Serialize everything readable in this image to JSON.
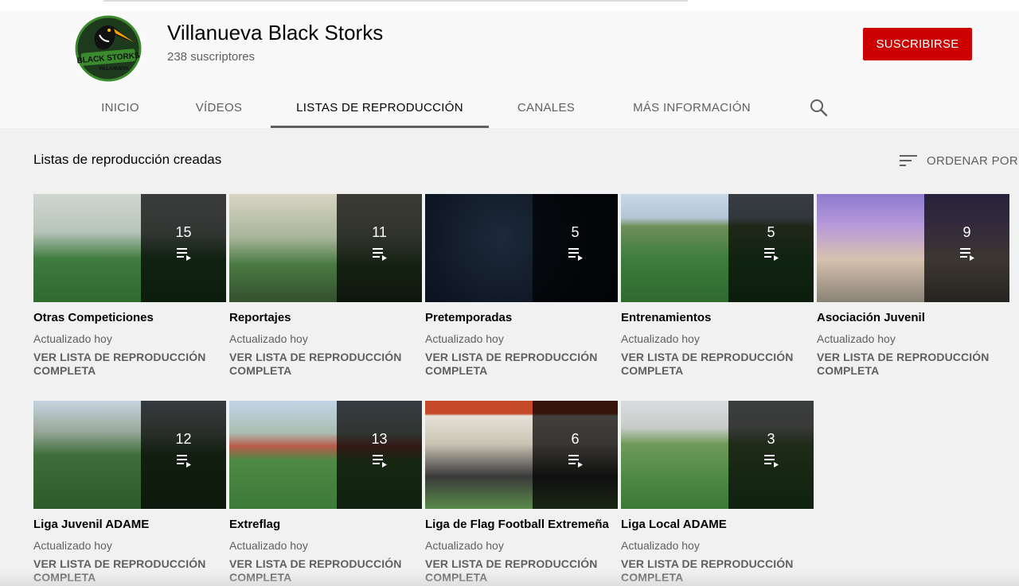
{
  "channel": {
    "name": "Villanueva Black Storks",
    "subscribers": "238 suscriptores",
    "subscribe_label": "SUSCRIBIRSE",
    "logo_text": "BLACK STORKS",
    "logo_subtext": "VILLANUEVA"
  },
  "tabs": [
    {
      "label": "INICIO"
    },
    {
      "label": "VÍDEOS"
    },
    {
      "label": "LISTAS DE REPRODUCCIÓN"
    },
    {
      "label": "CANALES"
    },
    {
      "label": "MÁS INFORMACIÓN"
    }
  ],
  "active_tab": "LISTAS DE REPRODUCCIÓN",
  "section": {
    "title": "Listas de reproducción creadas",
    "sort_label": "ORDENAR POR"
  },
  "icons": {
    "search": "search-icon",
    "sort": "sort-icon",
    "playlist": "playlist-icon"
  },
  "colors": {
    "subscribe": "#cc0000",
    "page_bg": "#f1f1f1",
    "header_bg": "#f9f9f9"
  },
  "playlists": [
    {
      "title": "Otras Competiciones",
      "count": "15",
      "updated": "Actualizado hoy",
      "link": "VER LISTA DE REPRODUCCIÓN COMPLETA"
    },
    {
      "title": "Reportajes",
      "count": "11",
      "updated": "Actualizado hoy",
      "link": "VER LISTA DE REPRODUCCIÓN COMPLETA"
    },
    {
      "title": "Pretemporadas",
      "count": "5",
      "updated": "Actualizado hoy",
      "link": "VER LISTA DE REPRODUCCIÓN COMPLETA"
    },
    {
      "title": "Entrenamientos",
      "count": "5",
      "updated": "Actualizado hoy",
      "link": "VER LISTA DE REPRODUCCIÓN COMPLETA"
    },
    {
      "title": "Asociación Juvenil",
      "count": "9",
      "updated": "Actualizado hoy",
      "link": "VER LISTA DE REPRODUCCIÓN COMPLETA"
    },
    {
      "title": "Liga Juvenil ADAME",
      "count": "12",
      "updated": "Actualizado hoy",
      "link": "VER LISTA DE REPRODUCCIÓN COMPLETA"
    },
    {
      "title": "Extreflag",
      "count": "13",
      "updated": "Actualizado hoy",
      "link": "VER LISTA DE REPRODUCCIÓN COMPLETA"
    },
    {
      "title": "Liga de Flag Football Extremeña",
      "count": "6",
      "updated": "Actualizado hoy",
      "link": "VER LISTA DE REPRODUCCIÓN COMPLETA"
    },
    {
      "title": "Liga Local ADAME",
      "count": "3",
      "updated": "Actualizado hoy",
      "link": "VER LISTA DE REPRODUCCIÓN COMPLETA"
    }
  ]
}
